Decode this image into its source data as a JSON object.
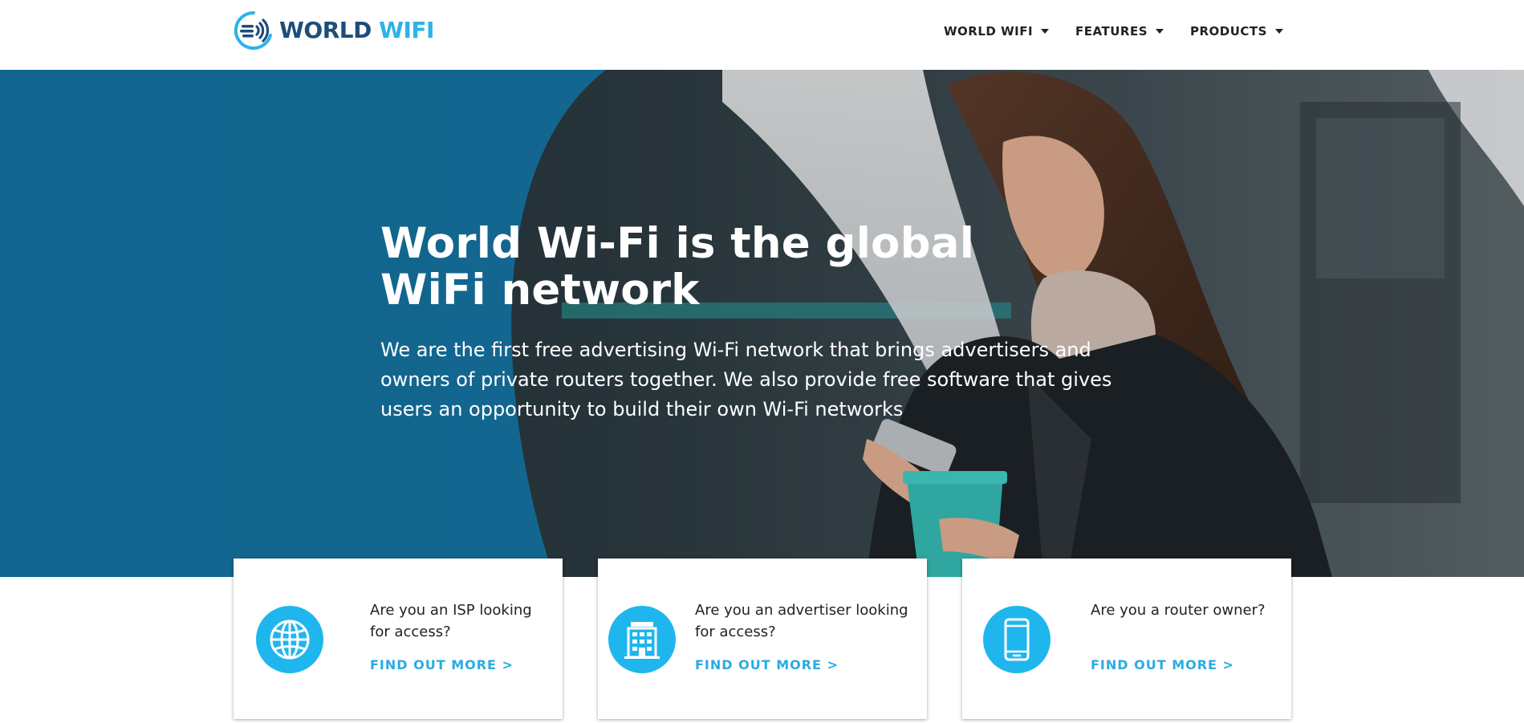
{
  "header": {
    "logo": {
      "word1": "WORLD",
      "word2": "WIFI"
    },
    "nav": [
      {
        "label": "WORLD WIFI"
      },
      {
        "label": "FEATURES"
      },
      {
        "label": "PRODUCTS"
      }
    ]
  },
  "hero": {
    "title_line1": "World Wi-Fi is the global",
    "title_line2": "WiFi network",
    "subtitle_line1": "We are the first free advertising Wi-Fi network that brings advertisers and",
    "subtitle_line2": "owners of private routers together. We also provide free software that gives",
    "subtitle_line3": "users an opportunity to build their own Wi-Fi networks"
  },
  "cards": [
    {
      "icon": "globe-icon",
      "question_line1": "Are you an ISP looking",
      "question_line2": "for access?",
      "link": "FIND OUT MORE >"
    },
    {
      "icon": "building-icon",
      "question_line1": "Are you an advertiser looking",
      "question_line2": "for access?",
      "link": "FIND OUT MORE >"
    },
    {
      "icon": "smartphone-icon",
      "question_line1": "Are you a router owner?",
      "question_line2": "",
      "link": "FIND OUT MORE >"
    }
  ],
  "colors": {
    "brand_dark": "#1d4e79",
    "brand_light": "#2bb3ea",
    "accent_blue": "#1fb6ee",
    "link_blue": "#29abe2",
    "hero_circle": "#1375a6"
  }
}
